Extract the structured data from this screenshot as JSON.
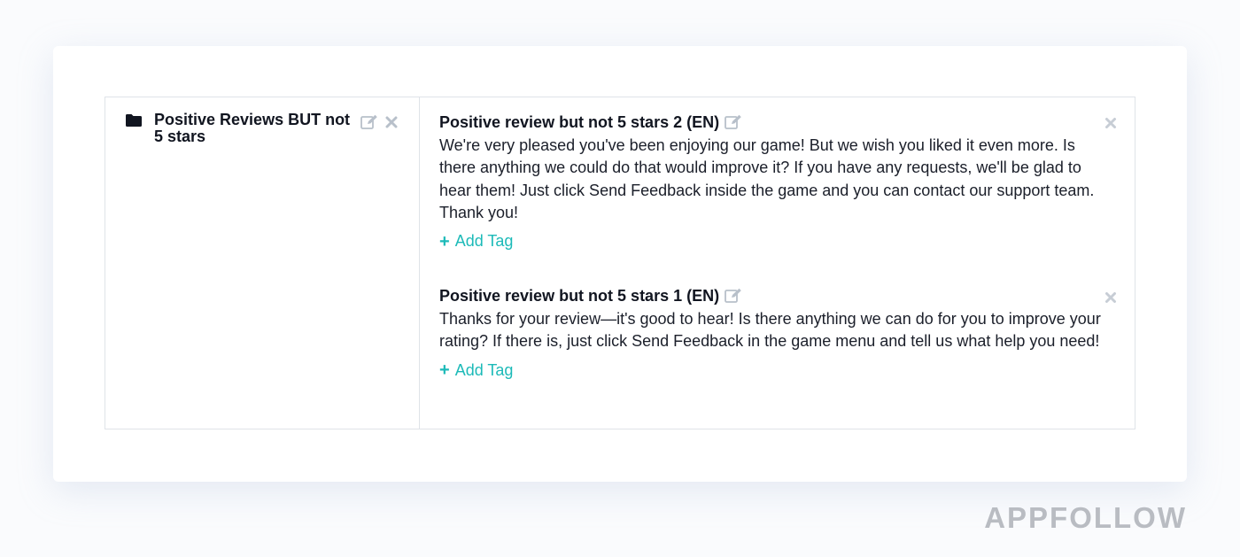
{
  "folder": {
    "name": "Positive Reviews BUT not 5 stars",
    "icon": "folder-icon",
    "edit_icon": "edit-icon",
    "delete_icon": "close-icon"
  },
  "templates": [
    {
      "title": "Positive review but not 5 stars 2 (EN)",
      "body": "We're very pleased you've been enjoying our game! But we wish you liked it even more. Is there anything we could do that would improve it? If you have any requests, we'll be glad to hear them! Just click Send Feedback inside the game and you can contact our support team. Thank you!",
      "add_tag_label": "Add Tag"
    },
    {
      "title": "Positive review but not 5 stars 1 (EN)",
      "body": "Thanks for your review—it's good to hear! Is there anything we can do for you to improve your rating? If there is, just click Send Feedback in the game menu and tell us what help you need!",
      "add_tag_label": "Add Tag"
    }
  ],
  "colors": {
    "accent": "#1cbab8",
    "icon_gray": "#b8c0ca",
    "border": "#dfe3e8"
  },
  "watermark": "APPFOLLOW"
}
